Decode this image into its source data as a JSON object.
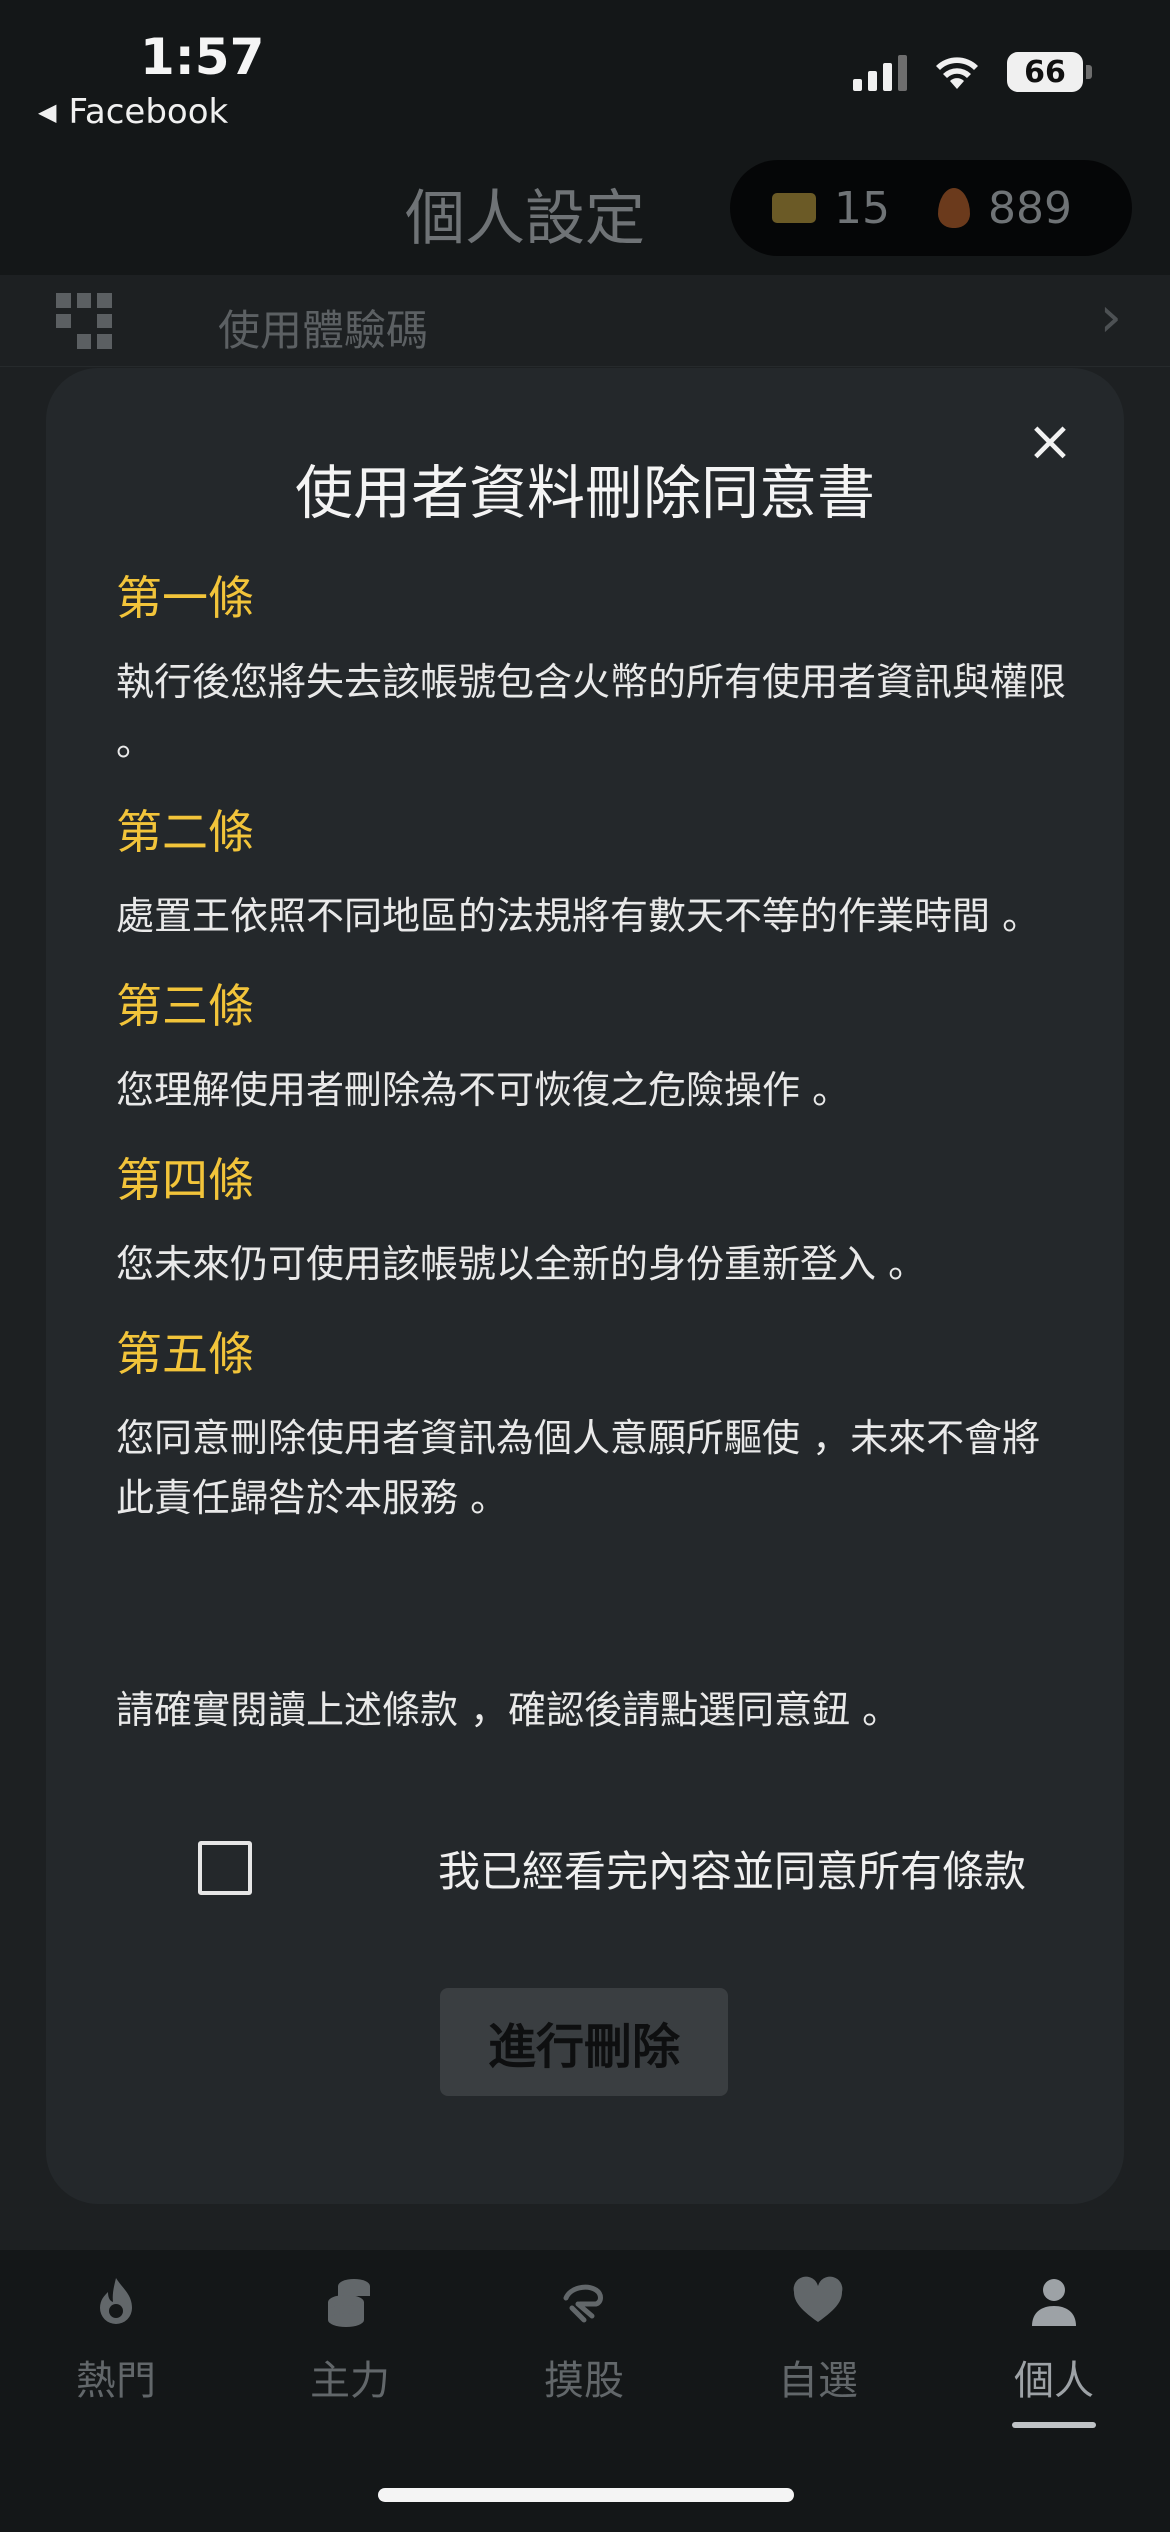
{
  "status_bar": {
    "time": "1:57",
    "back_app": "Facebook",
    "battery_level": "66"
  },
  "header": {
    "title": "個人設定",
    "tickets_count": "15",
    "fire_coins_count": "889"
  },
  "settings_row": {
    "label": "使用體驗碼"
  },
  "modal": {
    "title": "使用者資料刪除同意書",
    "clauses": [
      {
        "title": "第一條",
        "body": "執行後您將失去該帳號包含火幣的所有使用者資訊與權限 。"
      },
      {
        "title": "第二條",
        "body": "處置王依照不同地區的法規將有數天不等的作業時間 。"
      },
      {
        "title": "第三條",
        "body": "您理解使用者刪除為不可恢復之危險操作 。"
      },
      {
        "title": "第四條",
        "body": "您未來仍可使用該帳號以全新的身份重新登入 。"
      },
      {
        "title": "第五條",
        "body": "您同意刪除使用者資訊為個人意願所驅使 ，未來不會將此責任歸咎於本服務 。"
      }
    ],
    "confirm_note": "請確實閱讀上述條款 ，確認後請點選同意鈕 。",
    "agree_label": "我已經看完內容並同意所有條款",
    "agree_checked": false,
    "delete_button": "進行刪除"
  },
  "tabs": [
    {
      "label": "熱門",
      "icon": "flame-icon"
    },
    {
      "label": "主力",
      "icon": "coins-stack-icon"
    },
    {
      "label": "摸股",
      "icon": "hand-icon"
    },
    {
      "label": "自選",
      "icon": "heart-icon"
    },
    {
      "label": "個人",
      "icon": "person-icon",
      "active": true
    }
  ]
}
